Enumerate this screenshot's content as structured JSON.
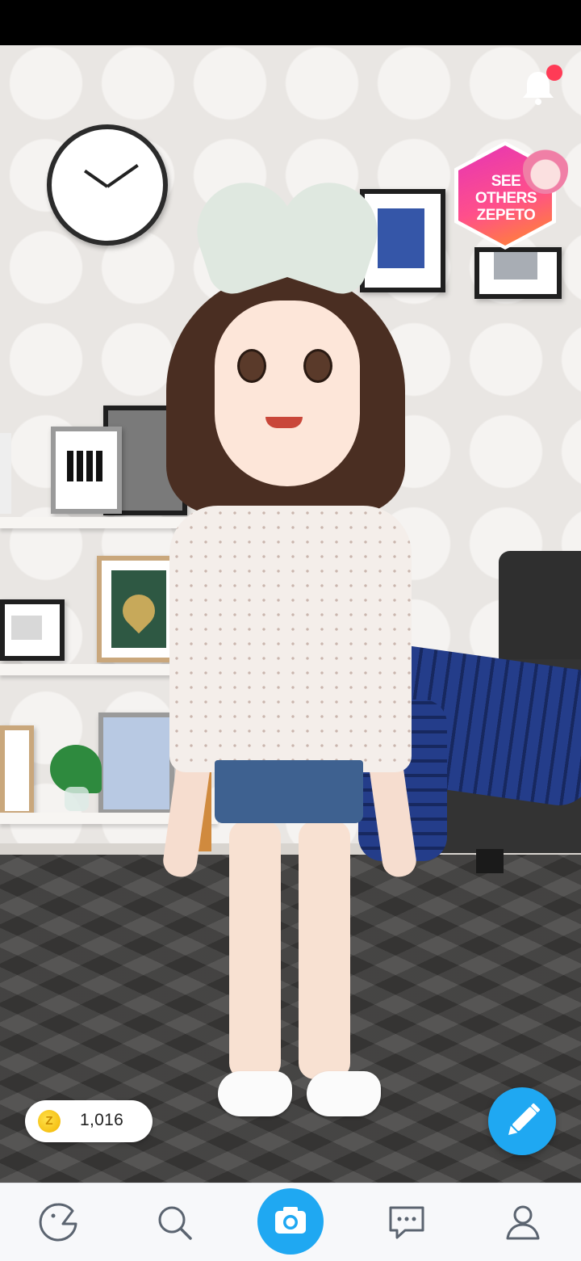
{
  "notifications": {
    "has_unread": true
  },
  "see_others": {
    "label_line1": "SEE",
    "label_line2": "OTHERS",
    "label_line3": "ZEPETO"
  },
  "wallet": {
    "coin_symbol": "Z",
    "coin_balance": "1,016"
  },
  "actions": {
    "edit_icon": "pencil-icon"
  },
  "bottom_nav": {
    "items": [
      {
        "icon": "zepeto-home-icon"
      },
      {
        "icon": "search-icon"
      },
      {
        "icon": "camera-icon",
        "active": true
      },
      {
        "icon": "chat-bubble-icon"
      },
      {
        "icon": "profile-icon"
      }
    ]
  },
  "colors": {
    "accent": "#1fa8f2",
    "notification_dot": "#ff3b56",
    "coin": "#f2b400"
  }
}
